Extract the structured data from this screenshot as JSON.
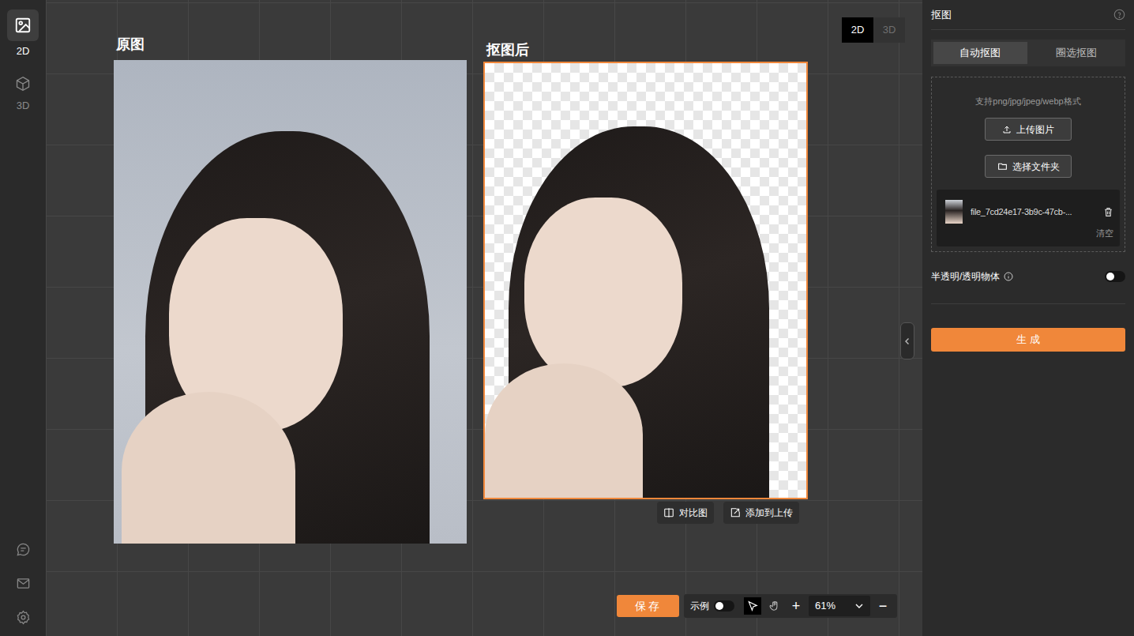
{
  "sidebar": {
    "items": [
      {
        "label": "2D",
        "selected": true
      },
      {
        "label": "3D",
        "selected": false
      }
    ]
  },
  "view_toggle": [
    {
      "label": "2D",
      "selected": true
    },
    {
      "label": "3D",
      "selected": false
    }
  ],
  "canvas": {
    "original": {
      "label": "原图"
    },
    "result": {
      "label": "抠图后",
      "selected": true
    }
  },
  "result_actions": [
    "对比图",
    "添加到上传"
  ],
  "toolbar": {
    "save": "保存",
    "example": {
      "label": "示例",
      "on": false
    },
    "tools": [
      {
        "selected": true
      },
      {
        "selected": false
      }
    ],
    "zoom_in": "+",
    "zoom": "61%",
    "zoom_out": "−"
  },
  "panel": {
    "title": "抠图",
    "tabs": [
      {
        "label": "自动抠图",
        "selected": true
      },
      {
        "label": "圈选抠图",
        "selected": false
      }
    ],
    "upload": {
      "hint": "支持png/jpg/jpeg/webp格式",
      "upload_button": "上传图片",
      "folder_button": "选择文件夹",
      "files": [
        {
          "name": "file_7cd24e17-3b9c-47cb-..."
        }
      ],
      "clear": "清空"
    },
    "transparent": {
      "label": "半透明/透明物体",
      "on": false
    },
    "generate": "生 成"
  }
}
